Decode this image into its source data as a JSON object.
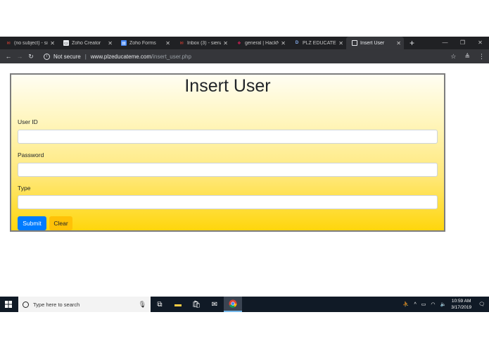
{
  "browser": {
    "tabs": [
      {
        "title": "(no subject) - sie",
        "icon": "gmail-icon",
        "active": false
      },
      {
        "title": "Zoho Creator",
        "icon": "zoho-creator-icon",
        "active": false
      },
      {
        "title": "Zoho Forms",
        "icon": "zoho-forms-icon",
        "active": false
      },
      {
        "title": "Inbox (3) - siena",
        "icon": "gmail-icon",
        "active": false
      },
      {
        "title": "general | HackN",
        "icon": "slack-icon",
        "active": false
      },
      {
        "title": "PLZ EDUCATE M",
        "icon": "plz-educate-icon",
        "active": false
      },
      {
        "title": "Insert User",
        "icon": "page-icon",
        "active": true
      }
    ],
    "security_text": "Not secure",
    "url_host": "www.plzeducateme.com",
    "url_path": "/insert_user.php"
  },
  "form": {
    "title": "Insert User",
    "user_id_label": "User ID",
    "user_id_value": "",
    "password_label": "Password",
    "password_value": "",
    "type_label": "Type",
    "type_value": "",
    "submit_label": "Submit",
    "clear_label": "Clear"
  },
  "taskbar": {
    "search_placeholder": "Type here to search",
    "time": "10:59 AM",
    "date": "3/17/2019"
  },
  "colors": {
    "submit": "#007bff",
    "clear": "#ffc107",
    "gradient_bottom": "#ffd60c"
  }
}
